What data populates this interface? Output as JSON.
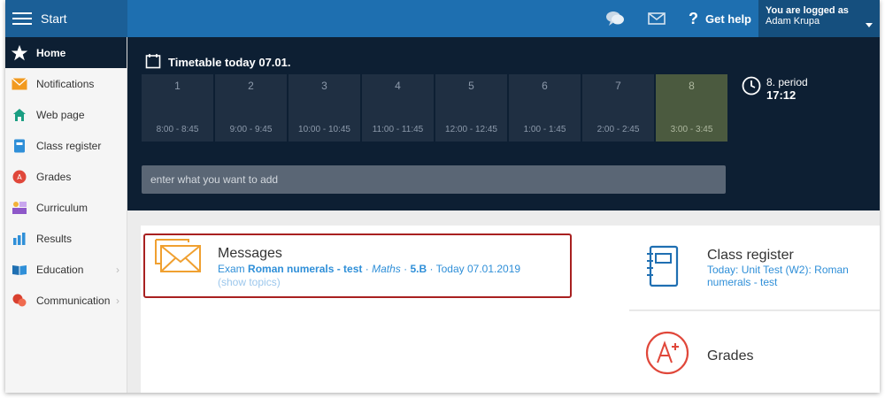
{
  "topbar": {
    "start_label": "Start",
    "help_label": "Get help",
    "help_glyph": "?",
    "user_caption": "You are logged as",
    "user_name": "Adam Krupa"
  },
  "sidebar": {
    "items": [
      {
        "label": "Home",
        "icon": "star-icon",
        "active": true
      },
      {
        "label": "Notifications",
        "icon": "envelope-icon"
      },
      {
        "label": "Web page",
        "icon": "house-icon"
      },
      {
        "label": "Class register",
        "icon": "notebook-icon"
      },
      {
        "label": "Grades",
        "icon": "grade-icon"
      },
      {
        "label": "Curriculum",
        "icon": "teacher-icon"
      },
      {
        "label": "Results",
        "icon": "bar-chart-icon"
      },
      {
        "label": "Education",
        "icon": "book-icon",
        "has_submenu": true
      },
      {
        "label": "Communication",
        "icon": "chat-icon",
        "has_submenu": true
      }
    ],
    "chevron": "›"
  },
  "timetable": {
    "title": "Timetable today 07.01.",
    "periods": [
      {
        "num": "1",
        "time": "8:00 - 8:45"
      },
      {
        "num": "2",
        "time": "9:00 - 9:45"
      },
      {
        "num": "3",
        "time": "10:00 - 10:45"
      },
      {
        "num": "4",
        "time": "11:00 - 11:45"
      },
      {
        "num": "5",
        "time": "12:00 - 12:45"
      },
      {
        "num": "6",
        "time": "1:00 - 1:45"
      },
      {
        "num": "7",
        "time": "2:00 - 2:45"
      },
      {
        "num": "8",
        "time": "3:00 - 3:45"
      }
    ],
    "current_period_label": "8. period",
    "current_time": "17:12",
    "add_placeholder": "enter what you want to add"
  },
  "messages": {
    "title": "Messages",
    "prefix": "Exam",
    "exam_name": "Roman numerals - test",
    "sep": "·",
    "subject": "Maths",
    "class": "5.B",
    "date": "Today 07.01.2019",
    "show_topics": "(show topics)"
  },
  "class_register": {
    "title": "Class register",
    "subtitle": "Today: Unit Test (W2): Roman numerals - test"
  },
  "grades": {
    "title": "Grades"
  },
  "colors": {
    "topbar": "#1e6fb0",
    "dark_panel": "#0d1f33",
    "link_blue": "#2f8fd8",
    "highlight_red": "#a82020",
    "messages_orange": "#f0a030"
  }
}
